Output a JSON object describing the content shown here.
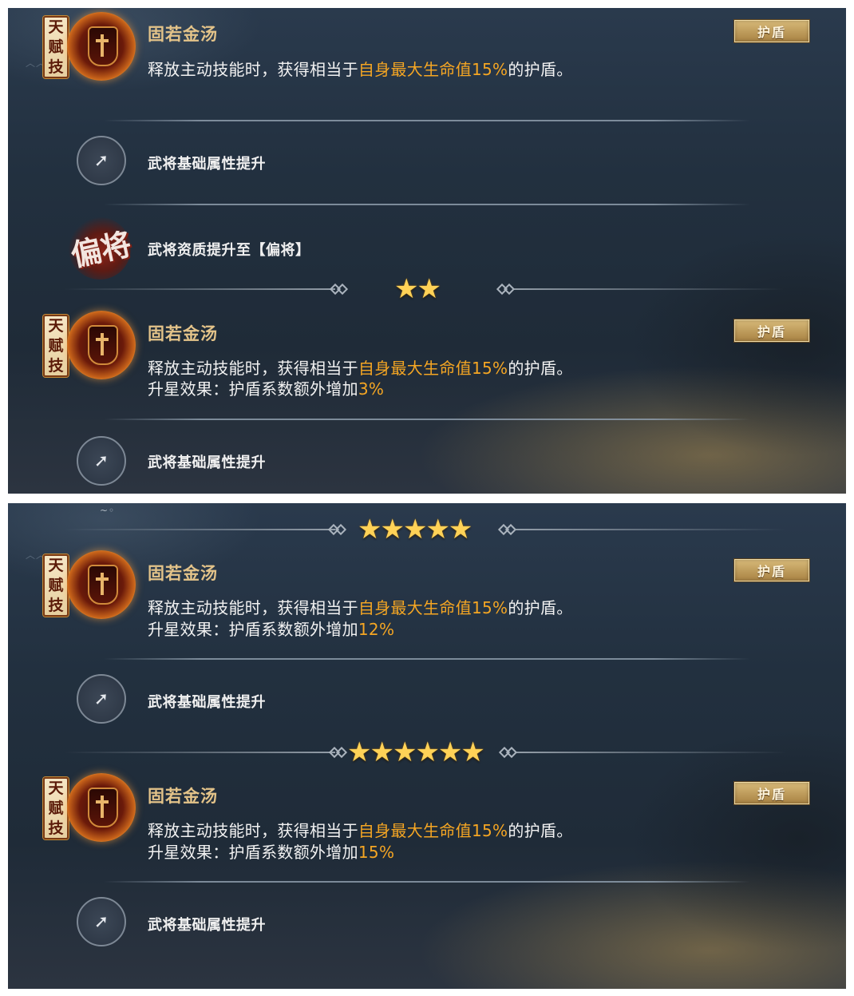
{
  "screens": [
    {
      "top_skill": {
        "badge": [
          "天",
          "赋",
          "技"
        ],
        "name": "固若金汤",
        "description_plain": "释放主动技能时，获得相当于",
        "description_highlight": "自身最大生命值15%",
        "description_tail": "的护盾。",
        "tag": "护盾"
      },
      "attr_row_1": "武将基础属性提升",
      "rank_icon_char": "偏将",
      "rank_row": "武将资质提升至【偏将】",
      "stars_1": "★★",
      "skill_2": {
        "badge": [
          "天",
          "赋",
          "技"
        ],
        "name": "固若金汤",
        "description_plain": "释放主动技能时，获得相当于",
        "description_highlight": "自身最大生命值15%",
        "description_tail": "的护盾。",
        "upgrade_prefix": "升星效果：护盾系数额外增加",
        "upgrade_value": "3%",
        "tag": "护盾"
      },
      "attr_row_2": "武将基础属性提升"
    },
    {
      "stars_5": "★★★★★",
      "skill_5": {
        "badge": [
          "天",
          "赋",
          "技"
        ],
        "name": "固若金汤",
        "description_plain": "释放主动技能时，获得相当于",
        "description_highlight": "自身最大生命值15%",
        "description_tail": "的护盾。",
        "upgrade_prefix": "升星效果：护盾系数额外增加",
        "upgrade_value": "12%",
        "tag": "护盾"
      },
      "attr_row_5": "武将基础属性提升",
      "stars_6": "★★★★★★",
      "skill_6": {
        "badge": [
          "天",
          "赋",
          "技"
        ],
        "name": "固若金汤",
        "description_plain": "释放主动技能时，获得相当于",
        "description_highlight": "自身最大生命值15%",
        "description_tail": "的护盾。",
        "upgrade_prefix": "升星效果：护盾系数额外增加",
        "upgrade_value": "15%",
        "tag": "护盾"
      },
      "attr_row_6": "武将基础属性提升"
    }
  ],
  "icons": {
    "attr_up": "arrow-up-icon",
    "shield": "shield-icon",
    "star": "star-icon"
  },
  "colors": {
    "highlight": "#f5a623",
    "skill_name": "#e3c389",
    "star": "#ffd257"
  }
}
